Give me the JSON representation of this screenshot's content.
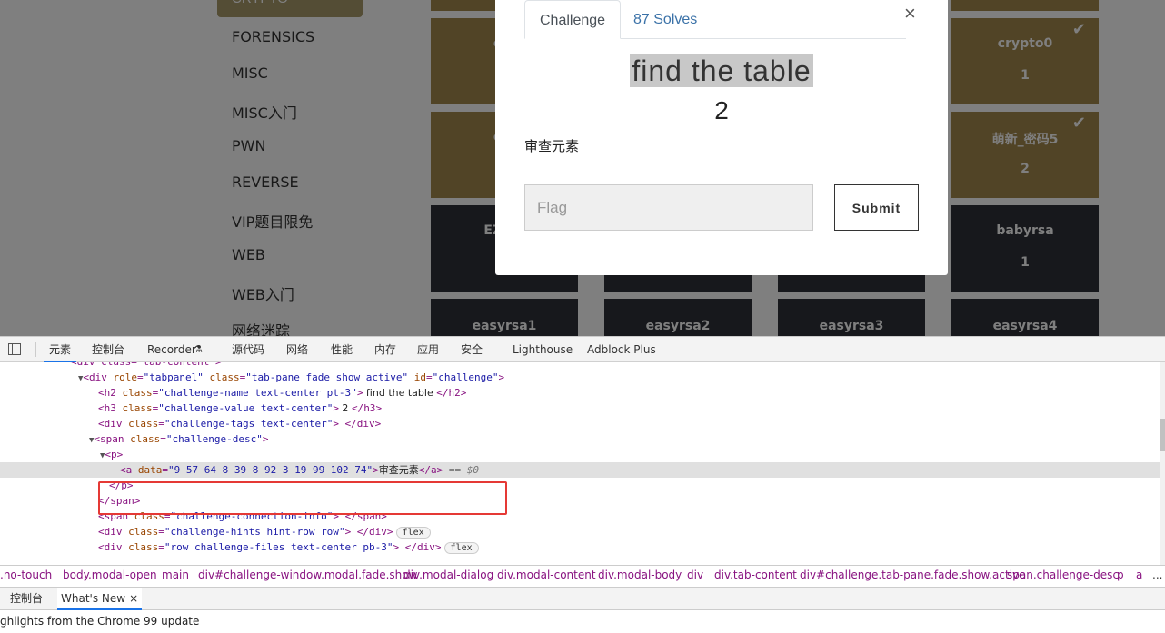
{
  "page": {
    "active_category": "CRYPTO",
    "categories": [
      "FORENSICS",
      "MISC",
      "MISC入门",
      "PWN",
      "REVERSE",
      "VIP题目限免",
      "WEB",
      "WEB入门",
      "网络迷踪"
    ],
    "tiles_row1": [
      {
        "name": "cry",
        "value": ""
      },
      {
        "name": "crypto0",
        "value": "1",
        "check": "✔"
      }
    ],
    "tiles_row2": [
      {
        "name": "cry",
        "value": ""
      },
      {
        "name": "萌新_密码5",
        "value": "2",
        "check": "✔"
      }
    ],
    "tiles_row3": [
      {
        "name": "EZ_av",
        "value": ""
      },
      {
        "name": "babyrsa",
        "value": "1"
      }
    ],
    "tiles_row4": [
      "easyrsa1",
      "easyrsa2",
      "easyrsa3",
      "easyrsa4"
    ],
    "colors": {
      "solved": "#a3894c",
      "unsolved": "#2f3138"
    }
  },
  "modal": {
    "tab_challenge": "Challenge",
    "tab_solves": "87 Solves",
    "close": "×",
    "challenge_name": "find the table",
    "challenge_value": "2",
    "description": "审查元素",
    "flag_placeholder": "Flag",
    "submit_label": "Submit"
  },
  "devtools": {
    "tabs": [
      "元素",
      "控制台",
      "Recorder",
      "源代码",
      "网络",
      "性能",
      "内存",
      "应用",
      "安全",
      "Lighthouse",
      "Adblock Plus"
    ],
    "recorder_icon": "flask-icon",
    "dom": {
      "l0": "<div class=\"tab-content\">",
      "l1_tag": "div",
      "l1_attrs": [
        [
          "role",
          "tabpanel"
        ],
        [
          "class",
          "tab-pane fade show active"
        ],
        [
          "id",
          "challenge"
        ]
      ],
      "l2_a": "h2",
      "l2_class": "challenge-name text-center pt-3",
      "l2_text": " find the table ",
      "l3_a": "h3",
      "l3_class": "challenge-value text-center",
      "l3_text": " 2 ",
      "l4_class": "challenge-tags text-center",
      "l5_class": "challenge-desc",
      "l7_data": "9 57 64 8 39 8 92 3 19 99 102 74",
      "l7_text": "审查元素",
      "l7_suffix": " == $0",
      "l10_class": "challenge-connection-info",
      "l11_class": "challenge-hints hint-row row",
      "l12_class": "row challenge-files text-center pb-3",
      "pill": "flex"
    },
    "breadcrumbs": [
      ".no-touch",
      "body.modal-open",
      "main",
      "div#challenge-window.modal.fade.show",
      "div.modal-dialog",
      "div.modal-content",
      "div.modal-body",
      "div",
      "div.tab-content",
      "div#challenge.tab-pane.fade.show.active",
      "span.challenge-desc",
      "p",
      "a",
      "..."
    ],
    "drawer_tabs": [
      "控制台",
      "What's New"
    ],
    "drawer_close": "×",
    "drawer_text": "ghlights from the Chrome 99 update"
  }
}
